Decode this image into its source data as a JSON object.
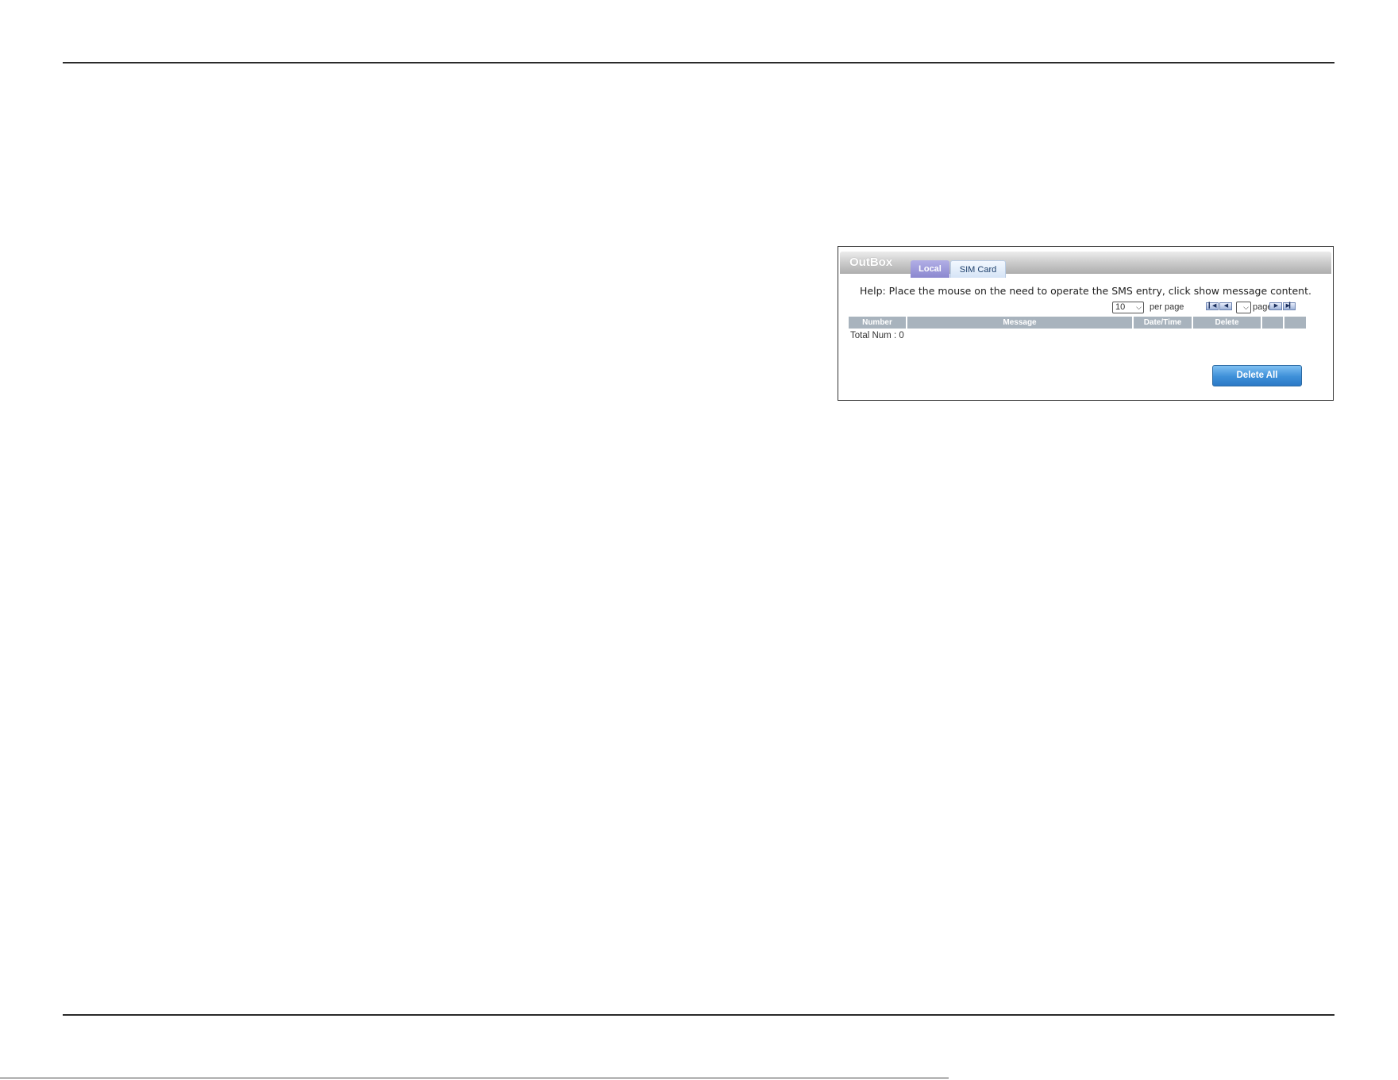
{
  "panel": {
    "title": "OutBox",
    "tabs": [
      {
        "label": "Local",
        "active": true
      },
      {
        "label": "SIM Card",
        "active": false
      }
    ],
    "help_text": "Help: Place the mouse on the need to operate the SMS entry, click show message content.",
    "pager": {
      "per_page_value": "10",
      "per_page_label": "per page",
      "page_label": "page",
      "page_value": "",
      "first_icon": "first-page-icon",
      "prev_icon": "prev-page-icon",
      "next_icon": "next-page-icon",
      "last_icon": "last-page-icon"
    },
    "table": {
      "columns": [
        "Number",
        "Message",
        "Date/Time",
        "Delete",
        "",
        ""
      ]
    },
    "total_text": "Total Num : 0",
    "delete_all_label": "Delete All"
  },
  "colors": {
    "tab_local": "#8b87cf",
    "tab_sim": "#d5e4f6",
    "table_header": "#a8b3bd",
    "button_primary": "#3d8fd8"
  }
}
